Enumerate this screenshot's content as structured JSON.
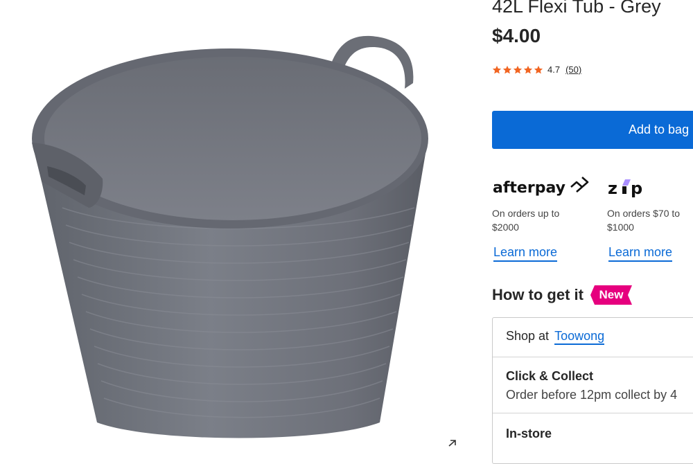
{
  "product": {
    "title": "42L Flexi Tub - Grey",
    "price": "$4.00",
    "rating_value": "4.7",
    "rating_count": "(50)",
    "rating_stars": 4.7,
    "image_alt": "Grey flexible tub with two handles",
    "expand_icon": "expand-arrow-icon"
  },
  "actions": {
    "add_to_bag": "Add to bag"
  },
  "payments": [
    {
      "brand": "afterpay",
      "description": "On orders up to $2000",
      "link": "Learn more"
    },
    {
      "brand": "zip",
      "description": "On orders $70 to $1000",
      "link": "Learn more"
    }
  ],
  "fulfilment": {
    "heading": "How to get it",
    "badge": "New",
    "shop_at_label": "Shop at",
    "store": "Toowong",
    "click_collect_title": "Click & Collect",
    "click_collect_sub": "Order before 12pm collect by 4",
    "in_store_title": "In-store"
  },
  "colors": {
    "primary": "#0a6ad6",
    "badge": "#e6007e",
    "star": "#f16522",
    "tub": "#6d7079"
  }
}
